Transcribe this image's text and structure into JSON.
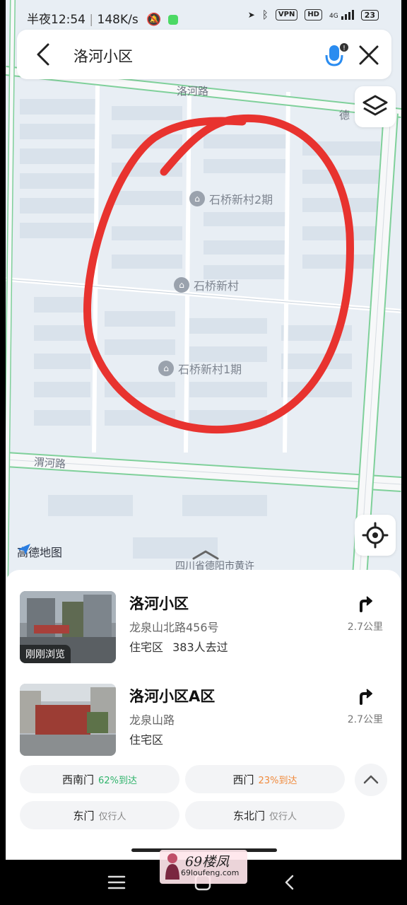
{
  "status_bar": {
    "time": "半夜12:54",
    "speed": "148K/s",
    "vpn": "VPN",
    "hd": "HD",
    "network": "4G",
    "battery": "23"
  },
  "search": {
    "query": "洛河小区"
  },
  "map": {
    "road_labels": [
      "洛河路",
      "德",
      "渭河路"
    ],
    "pois": [
      "石桥新村2期",
      "石桥新村",
      "石桥新村1期"
    ],
    "bottom_label": "四川省德阳市黄许",
    "logo_text": "高德地图",
    "annotation_color": "#e8332f"
  },
  "results": [
    {
      "title": "洛河小区",
      "address": "龙泉山北路456号",
      "type": "住宅区",
      "visits": "383人去过",
      "distance": "2.7公里",
      "badge": "刚刚浏览"
    },
    {
      "title": "洛河小区A区",
      "address": "龙泉山路",
      "type": "住宅区",
      "distance": "2.7公里"
    }
  ],
  "gates": [
    {
      "name": "西南门",
      "tag": "62%到达",
      "tag_color": "#2fb36b"
    },
    {
      "name": "西门",
      "tag": "23%到达",
      "tag_color": "#f08a3c"
    },
    {
      "name": "东门",
      "tag": "仅行人",
      "tag_color": "#888888"
    },
    {
      "name": "东北门",
      "tag": "仅行人",
      "tag_color": "#888888"
    }
  ],
  "watermark": {
    "main": "69楼凤",
    "sub": "69loufeng.com"
  }
}
